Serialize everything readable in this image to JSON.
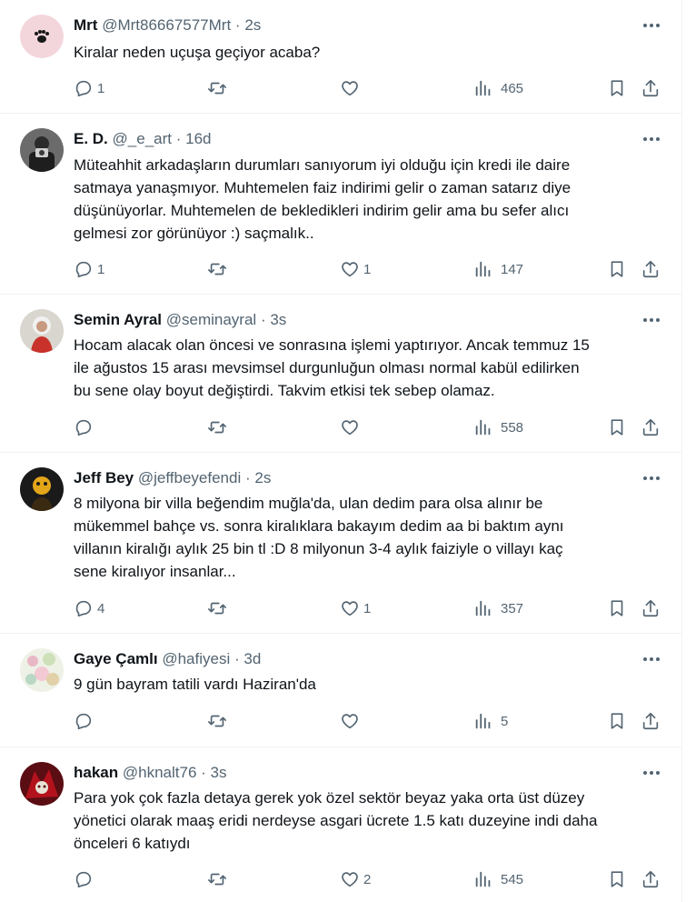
{
  "colors": {
    "text": "#0f1419",
    "muted": "#536471",
    "divider": "#eff3f4"
  },
  "icons": {
    "reply": "reply-icon",
    "retweet": "retweet-icon",
    "like": "heart-icon",
    "views": "views-bar-chart-icon",
    "bookmark": "bookmark-icon",
    "share": "share-icon",
    "more": "more-dots-icon"
  },
  "tweets": [
    {
      "name": "Mrt",
      "handle": "@Mrt86667577Mrt",
      "dot": "·",
      "time": "2s",
      "text": "Kiralar neden uçuşa geçiyor acaba?",
      "replies": "1",
      "retweets": "",
      "likes": "",
      "views": "465"
    },
    {
      "name": "E. D.",
      "handle": "@_e_art",
      "dot": "·",
      "time": "16d",
      "text": "Müteahhit arkadaşların durumları sanıyorum iyi olduğu için kredi ile daire\nsatmaya yanaşmıyor. Muhtemelen faiz indirimi gelir o zaman satarız diye\ndüşünüyorlar. Muhtemelen de bekledikleri indirim gelir ama bu sefer alıcı\ngelmesi zor görünüyor :) saçmalık..",
      "replies": "1",
      "retweets": "",
      "likes": "1",
      "views": "147"
    },
    {
      "name": "Semin Ayral",
      "handle": "@seminayral",
      "dot": "·",
      "time": "3s",
      "text": "Hocam alacak olan öncesi ve sonrasına işlemi yaptırıyor. Ancak temmuz 15\nile ağustos 15 arası mevsimsel durgunluğun olması normal kabül edilirken\nbu sene olay boyut değiştirdi. Takvim etkisi tek sebep olamaz.",
      "replies": "",
      "retweets": "",
      "likes": "",
      "views": "558"
    },
    {
      "name": "Jeff Bey",
      "handle": "@jeffbeyefendi",
      "dot": "·",
      "time": "2s",
      "text": "8 milyona bir villa beğendim muğla'da, ulan dedim para olsa alınır be\nmükemmel bahçe vs. sonra kiralıklara bakayım dedim aa bi baktım aynı\nvillanın kiralığı aylık 25 bin tl :D 8 milyonun 3-4 aylık faiziyle o villayı kaç\nsene kiralıyor insanlar...",
      "replies": "4",
      "retweets": "",
      "likes": "1",
      "views": "357"
    },
    {
      "name": "Gaye Çamlı",
      "handle": "@hafiyesi",
      "dot": "·",
      "time": "3d",
      "text": "9 gün bayram tatili vardı Haziran'da",
      "replies": "",
      "retweets": "",
      "likes": "",
      "views": "5"
    },
    {
      "name": "hakan",
      "handle": "@hknalt76",
      "dot": "·",
      "time": "3s",
      "text": "Para yok çok fazla detaya gerek yok özel sektör beyaz yaka orta üst düzey\nyönetici olarak maaş eridi nerdeyse asgari ücrete 1.5 katı duzeyine indi daha\nönceleri 6 katıydı",
      "replies": "",
      "retweets": "",
      "likes": "2",
      "views": "545"
    }
  ]
}
